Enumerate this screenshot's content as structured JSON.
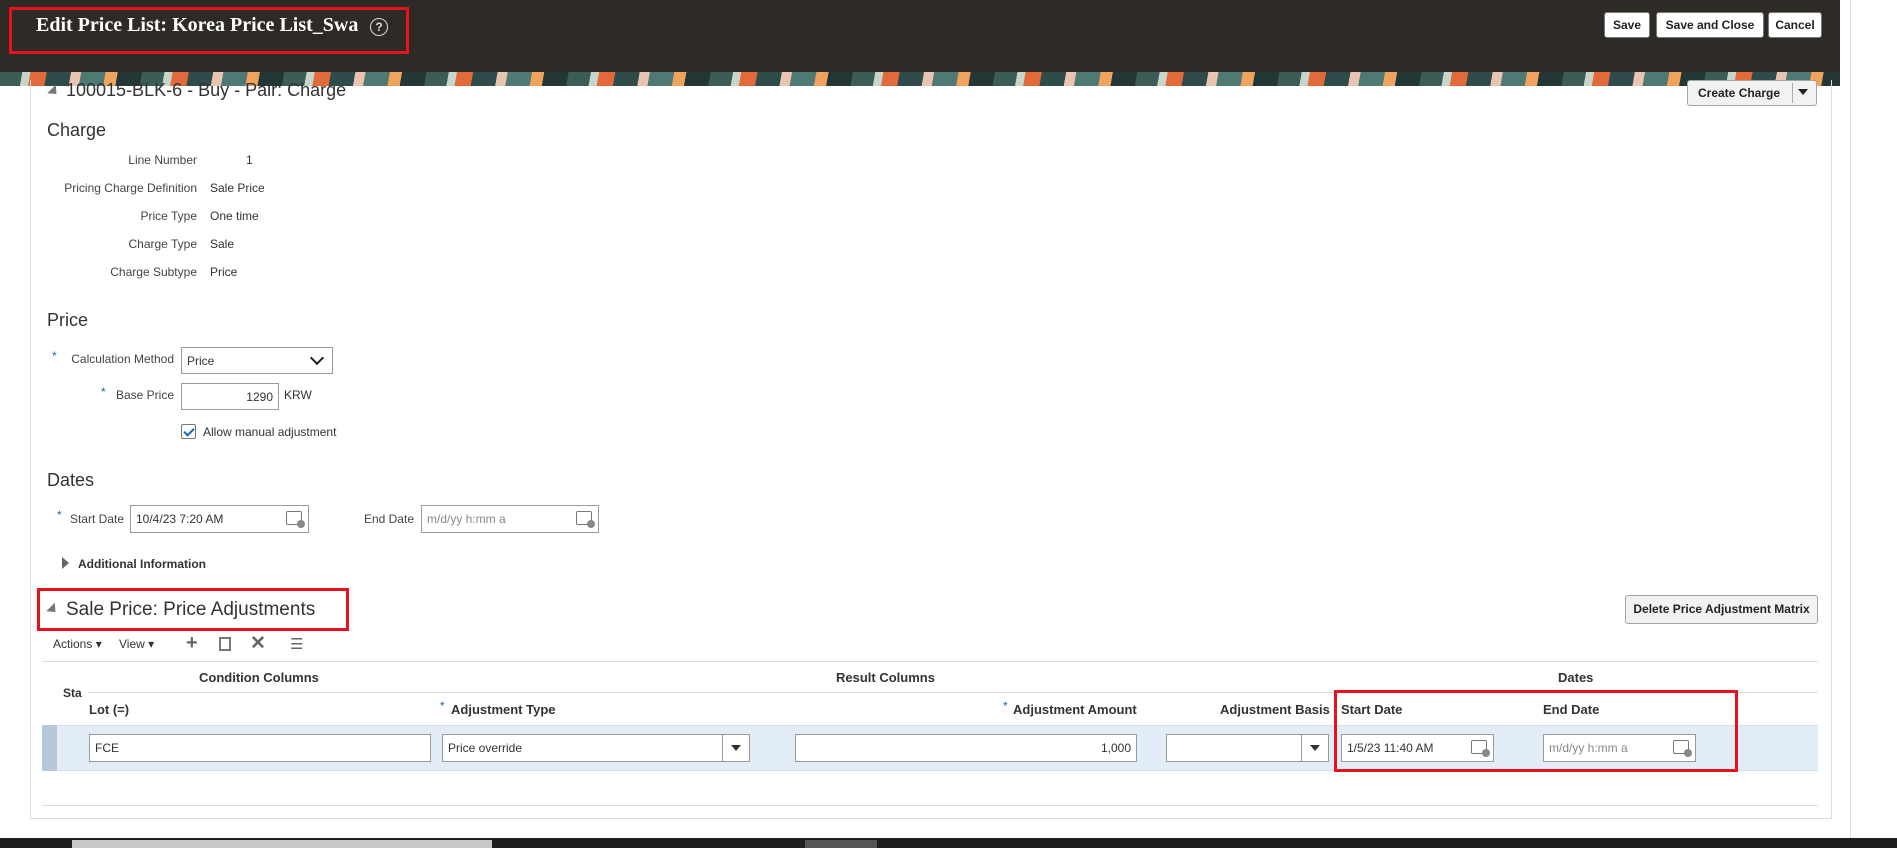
{
  "header": {
    "title": "Edit Price List: Korea Price List_Swa",
    "help_icon": "?",
    "save": "Save",
    "save_close": "Save and Close",
    "cancel": "Cancel"
  },
  "charge_header": {
    "title": "100015-BLK-6 - Buy - Pair: Charge",
    "create_charge": "Create Charge"
  },
  "charge": {
    "heading": "Charge",
    "fields": [
      {
        "label": "Line Number",
        "value": "1"
      },
      {
        "label": "Pricing Charge Definition",
        "value": "Sale Price"
      },
      {
        "label": "Price Type",
        "value": "One time"
      },
      {
        "label": "Charge Type",
        "value": "Sale"
      },
      {
        "label": "Charge Subtype",
        "value": "Price"
      }
    ]
  },
  "price": {
    "heading": "Price",
    "calc_method_label": "Calculation Method",
    "calc_method_value": "Price",
    "base_price_label": "Base Price",
    "base_price_value": "1290",
    "currency": "KRW",
    "allow_manual_label": "Allow manual adjustment",
    "allow_manual_checked": true
  },
  "dates": {
    "heading": "Dates",
    "start_label": "Start Date",
    "start_value": "10/4/23 7:20 AM",
    "end_label": "End Date",
    "end_placeholder": "m/d/yy h:mm a",
    "additional_info": "Additional Information"
  },
  "adjustments": {
    "title": "Sale Price: Price Adjustments",
    "delete_button": "Delete Price Adjustment Matrix",
    "toolbar": {
      "actions": "Actions",
      "view": "View"
    },
    "groups": {
      "condition": "Condition Columns",
      "result": "Result Columns",
      "dates": "Dates"
    },
    "columns": {
      "status": "Sta",
      "lot": "Lot (=)",
      "adjustment_type": "Adjustment Type",
      "adjustment_amount": "Adjustment Amount",
      "adjustment_basis": "Adjustment Basis",
      "start_date": "Start Date",
      "end_date": "End Date"
    },
    "row": {
      "lot": "FCE",
      "adjustment_type": "Price override",
      "adjustment_amount": "1,000",
      "adjustment_basis": "",
      "start_date": "1/5/23 11:40 AM",
      "end_date_placeholder": "m/d/yy h:mm a"
    }
  },
  "colors": {
    "header_bg": "#2e2a26",
    "highlight": "#e8121e",
    "row_selected": "#e2edf7",
    "required": "#1a66b8"
  }
}
